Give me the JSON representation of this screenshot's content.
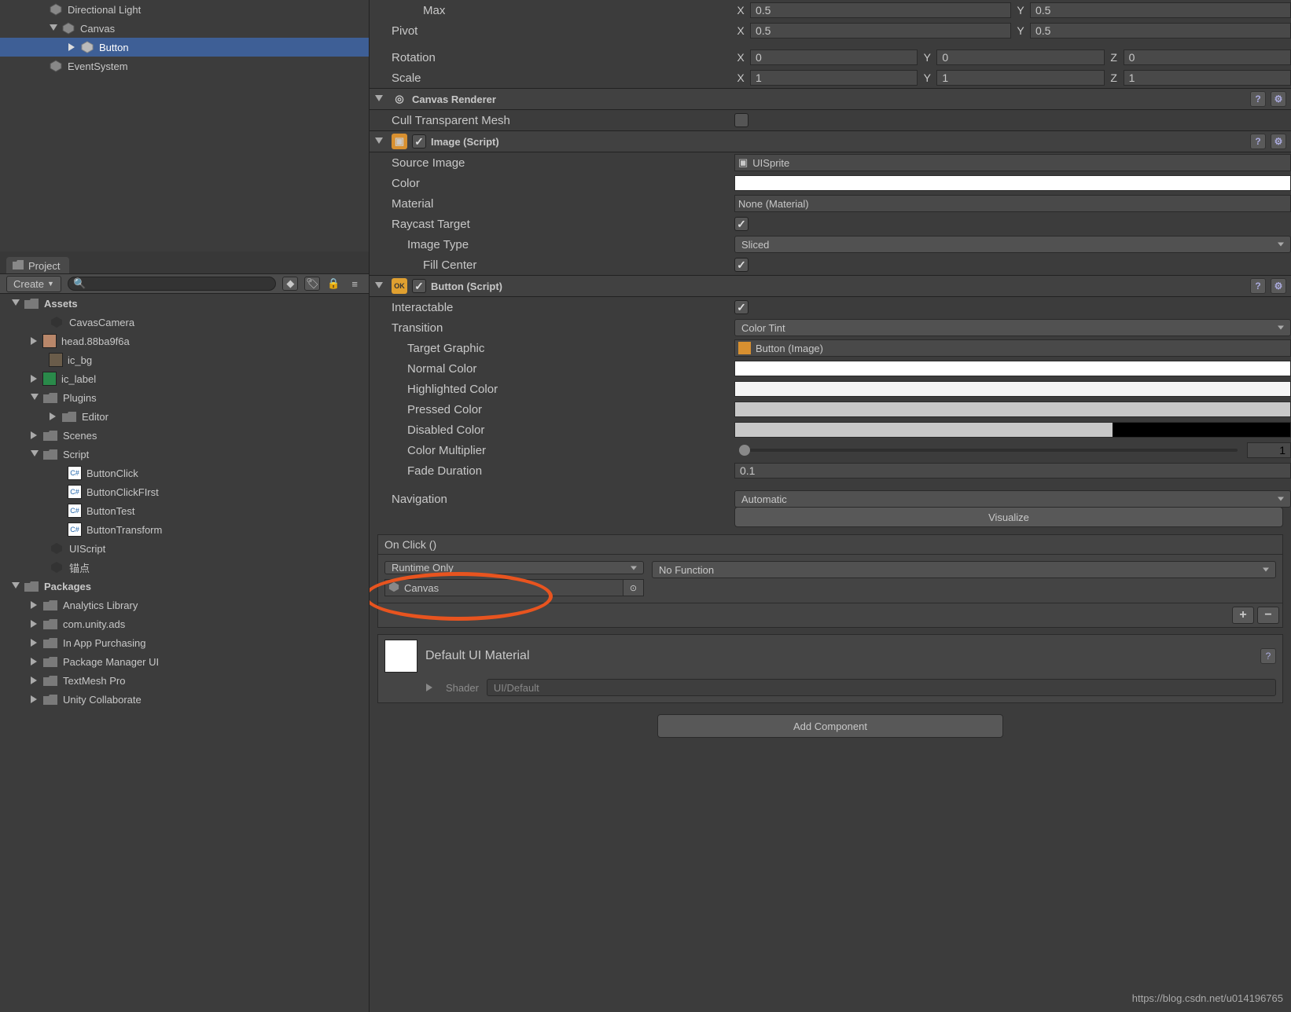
{
  "hierarchy": {
    "items": [
      {
        "label": "Directional Light"
      },
      {
        "label": "Canvas"
      },
      {
        "label": "Button"
      },
      {
        "label": "EventSystem"
      }
    ]
  },
  "project": {
    "tab_label": "Project",
    "create_label": "Create",
    "tree": {
      "assets": "Assets",
      "cavas_camera": "CavasCamera",
      "head": "head.88ba9f6a",
      "ic_bg": "ic_bg",
      "ic_label": "ic_label",
      "plugins": "Plugins",
      "editor": "Editor",
      "scenes": "Scenes",
      "script": "Script",
      "button_click": "ButtonClick",
      "button_click_first": "ButtonClickFIrst",
      "button_test": "ButtonTest",
      "button_transform": "ButtonTransform",
      "uiscript": "UIScript",
      "anchor": "锚点",
      "packages": "Packages",
      "analytics": "Analytics Library",
      "ads": "com.unity.ads",
      "iap": "In App Purchasing",
      "pkgmgr": "Package Manager UI",
      "tmp": "TextMesh Pro",
      "collab": "Unity Collaborate"
    }
  },
  "transform": {
    "max_label": "Max",
    "max_x": "0.5",
    "max_y": "0.5",
    "pivot_label": "Pivot",
    "pivot_x": "0.5",
    "pivot_y": "0.5",
    "rotation_label": "Rotation",
    "rot_x": "0",
    "rot_y": "0",
    "rot_z": "0",
    "scale_label": "Scale",
    "scale_x": "1",
    "scale_y": "1",
    "scale_z": "1"
  },
  "canvas_renderer": {
    "title": "Canvas Renderer",
    "cull_label": "Cull Transparent Mesh"
  },
  "image": {
    "title": "Image (Script)",
    "source_label": "Source Image",
    "source_value": "UISprite",
    "color_label": "Color",
    "color_value": "#ffffff",
    "material_label": "Material",
    "material_value": "None (Material)",
    "raycast_label": "Raycast Target",
    "type_label": "Image Type",
    "type_value": "Sliced",
    "fill_label": "Fill Center"
  },
  "button": {
    "title": "Button (Script)",
    "interactable_label": "Interactable",
    "transition_label": "Transition",
    "transition_value": "Color Tint",
    "target_label": "Target Graphic",
    "target_value": "Button (Image)",
    "normal_label": "Normal Color",
    "normal_color": "#ffffff",
    "highlighted_label": "Highlighted Color",
    "highlighted_color": "#f5f5f5",
    "pressed_label": "Pressed Color",
    "pressed_color": "#c8c8c8",
    "disabled_label": "Disabled Color",
    "disabled_color": "#c8c8c8",
    "multiplier_label": "Color Multiplier",
    "multiplier_value": "1",
    "fade_label": "Fade Duration",
    "fade_value": "0.1",
    "navigation_label": "Navigation",
    "navigation_value": "Automatic",
    "visualize_label": "Visualize"
  },
  "onclick": {
    "header": "On Click ()",
    "mode_value": "Runtime Only",
    "target_value": "Canvas",
    "function_value": "No Function"
  },
  "material": {
    "name": "Default UI Material",
    "shader_label": "Shader",
    "shader_value": "UI/Default"
  },
  "add_component_label": "Add Component",
  "watermark": "https://blog.csdn.net/u014196765"
}
